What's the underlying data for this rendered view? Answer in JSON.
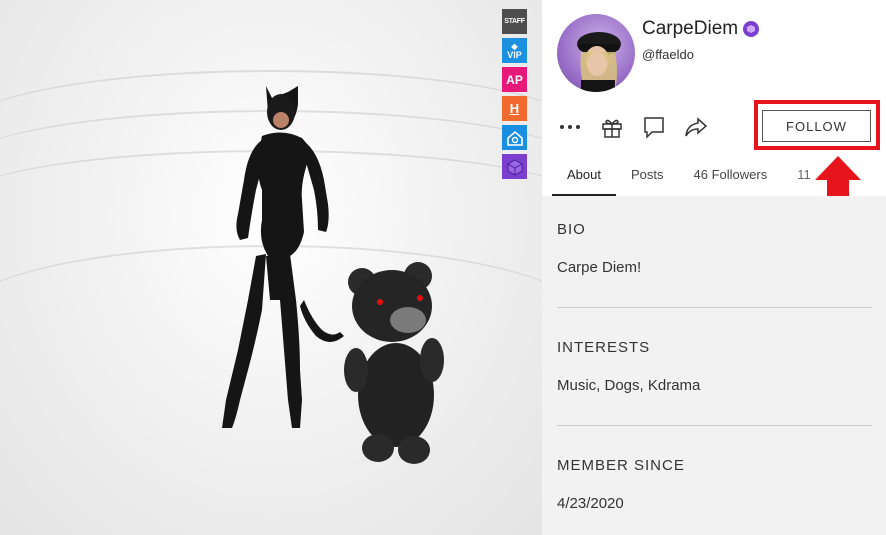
{
  "badges": [
    {
      "label": "STAFF",
      "icon": "staff-badge-icon"
    },
    {
      "label": "VIP",
      "icon": "vip-badge-icon"
    },
    {
      "label": "AP",
      "icon": "ap-badge-icon"
    },
    {
      "label": "H",
      "icon": "h-badge-icon"
    },
    {
      "label": "",
      "icon": "home-badge-icon"
    },
    {
      "label": "",
      "icon": "box-badge-icon"
    }
  ],
  "profile": {
    "username": "CarpeDiem",
    "handle": "@ffaeldo",
    "follow_label": "FOLLOW"
  },
  "tabs": [
    {
      "label": "About"
    },
    {
      "label": "Posts"
    },
    {
      "label": "46 Followers"
    },
    {
      "label": "11"
    }
  ],
  "sections": [
    {
      "title": "BIO",
      "value": "Carpe Diem!"
    },
    {
      "title": "INTERESTS",
      "value": "Music, Dogs, Kdrama"
    },
    {
      "title": "MEMBER SINCE",
      "value": "4/23/2020"
    }
  ],
  "colors": {
    "highlight": "#e8141c",
    "verified": "#7b3fd0"
  }
}
